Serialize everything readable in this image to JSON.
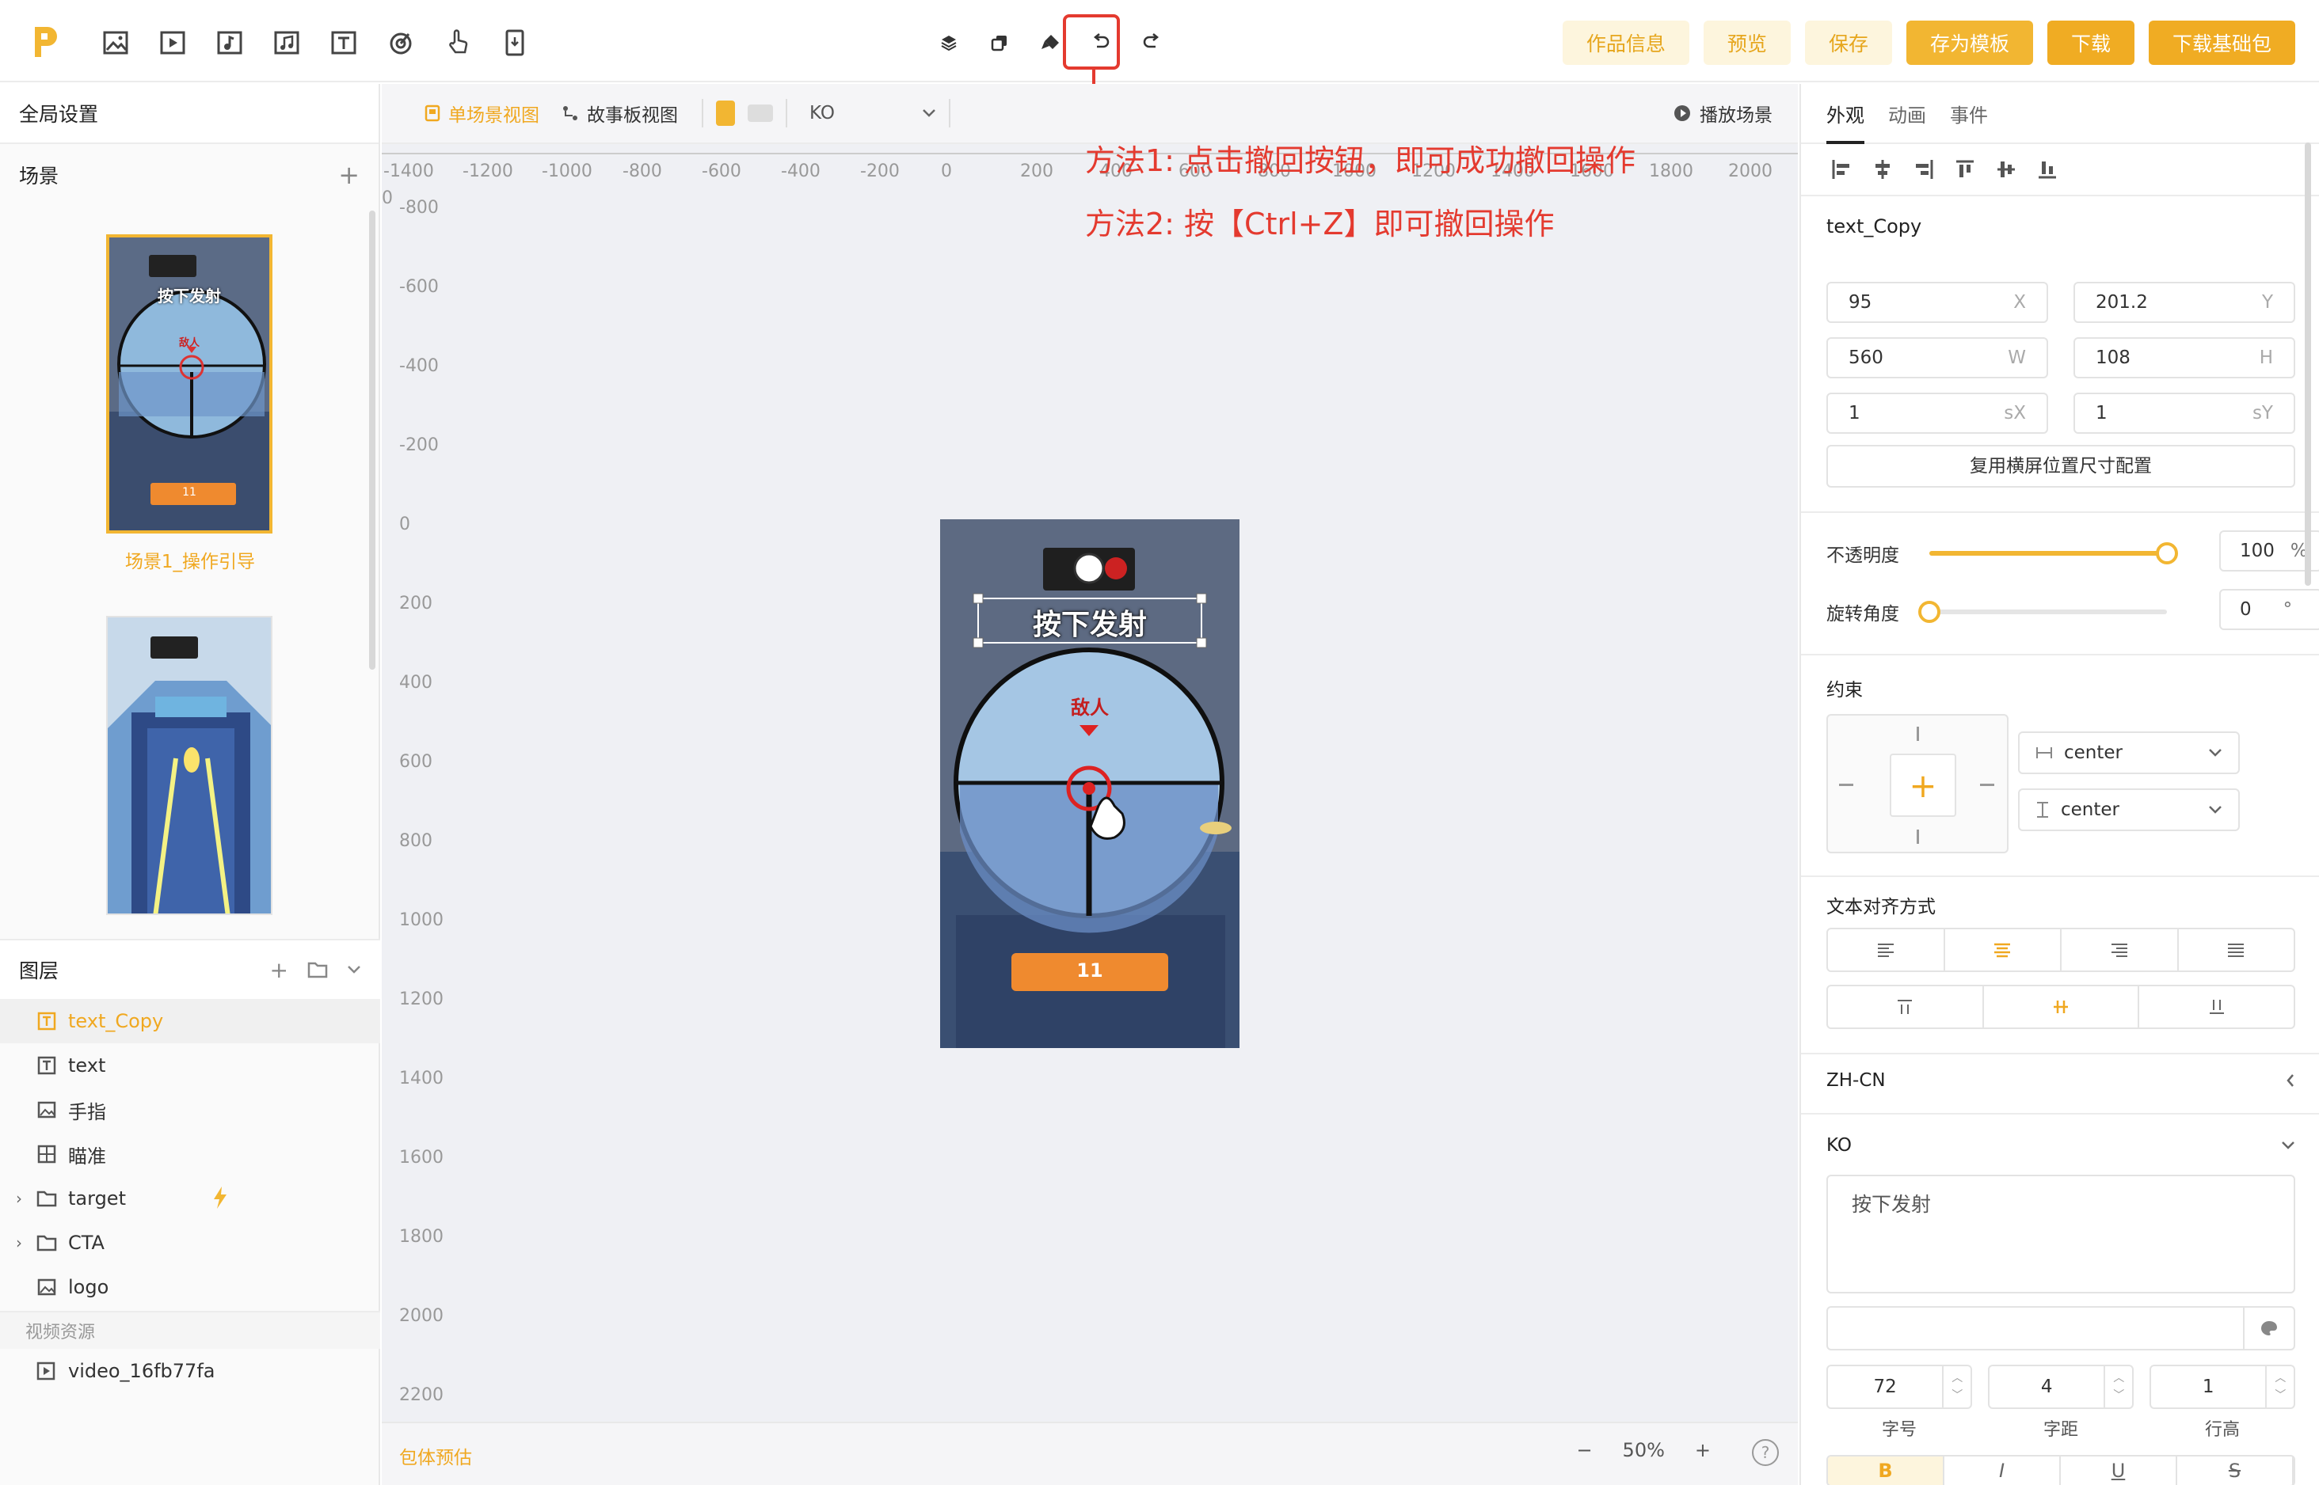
{
  "topbar": {
    "logo_letter": "P",
    "tool_icons": [
      "image-icon",
      "video-icon",
      "audio-note-icon",
      "music-icon",
      "text-icon",
      "target-icon",
      "hand-icon",
      "phone-icon"
    ],
    "center_icons": [
      "layers-icon",
      "copy-icon",
      "brush-icon",
      "undo-icon",
      "redo-icon"
    ],
    "buttons": {
      "info": "作品信息",
      "preview": "预览",
      "save": "保存",
      "save_template": "存为模板",
      "download": "下载",
      "download_base": "下载基础包"
    }
  },
  "left": {
    "global_settings": "全局设置",
    "scenes_title": "场景",
    "scene1_label": "场景1_操作引导",
    "layers_title": "图层",
    "layers": [
      {
        "name": "text_Copy",
        "icon": "text-layer-icon",
        "selected": true
      },
      {
        "name": "text",
        "icon": "text-layer-icon"
      },
      {
        "name": "手指",
        "icon": "image-layer-icon"
      },
      {
        "name": "瞄准",
        "icon": "component-icon"
      },
      {
        "name": "target",
        "icon": "folder-icon",
        "folder": true,
        "lightning": true
      },
      {
        "name": "CTA",
        "icon": "folder-icon",
        "folder": true
      },
      {
        "name": "logo",
        "icon": "image-layer-icon"
      }
    ],
    "video_section": "视频资源",
    "video_item": "video_16fb77fa"
  },
  "canvas": {
    "view_single": "单场景视图",
    "view_story": "故事板视图",
    "lang_select": "KO",
    "play_scene": "播放场景",
    "ruler_top": [
      "-1400",
      "-1200",
      "-1000",
      "-800",
      "-600",
      "-400",
      "-200",
      "0",
      "200",
      "400",
      "600",
      "800",
      "1000",
      "1200",
      "1400",
      "1600",
      "1800",
      "2000"
    ],
    "ruler_left": [
      "0",
      "-800",
      "-600",
      "-400",
      "-200",
      "0",
      "200",
      "400",
      "600",
      "800",
      "1000",
      "1200",
      "1400",
      "1600",
      "1800",
      "2000",
      "2200"
    ],
    "annotation_1": "方法1: 点击撤回按钮，即可成功撤回操作",
    "annotation_2": "方法2: 按【Ctrl+Z】即可撤回操作",
    "phone_caption": "按下发射",
    "phone_enemy": "敌人",
    "phone_counter": "11",
    "package_estimate": "包体预估",
    "zoom_minus": "−",
    "zoom_level": "50%",
    "zoom_plus": "+",
    "help": "?"
  },
  "thumb": {
    "caption": "按下发射",
    "enemy": "敌人",
    "counter": "11"
  },
  "right": {
    "tabs": [
      "外观",
      "动画",
      "事件"
    ],
    "element_name": "text_Copy",
    "x": "95",
    "x_unit": "X",
    "y": "201.2",
    "y_unit": "Y",
    "w": "560",
    "w_unit": "W",
    "h": "108",
    "h_unit": "H",
    "sx": "1",
    "sx_unit": "sX",
    "sy": "1",
    "sy_unit": "sY",
    "reuse_button": "复用横屏位置尺寸配置",
    "opacity_label": "不透明度",
    "opacity_value": "100",
    "opacity_unit": "%",
    "opacity_fraction": 1.0,
    "rotation_label": "旋转角度",
    "rotation_value": "0",
    "rotation_unit": "°",
    "rotation_fraction": 0.0,
    "constraint_label": "约束",
    "constraint_h": "center",
    "constraint_v": "center",
    "text_align_label": "文本对齐方式",
    "lang_zh": "ZH-CN",
    "lang_ko": "KO",
    "text_content": "按下发射",
    "font_size": "72",
    "letter_spacing": "4",
    "line_height": "1",
    "font_size_label": "字号",
    "letter_spacing_label": "字距",
    "line_height_label": "行高",
    "style_buttons": [
      "B",
      "I",
      "U",
      "S"
    ]
  },
  "colors": {
    "accent": "#f2b632",
    "accent_text": "#f0a820",
    "annotation_red": "#e43a2f"
  }
}
